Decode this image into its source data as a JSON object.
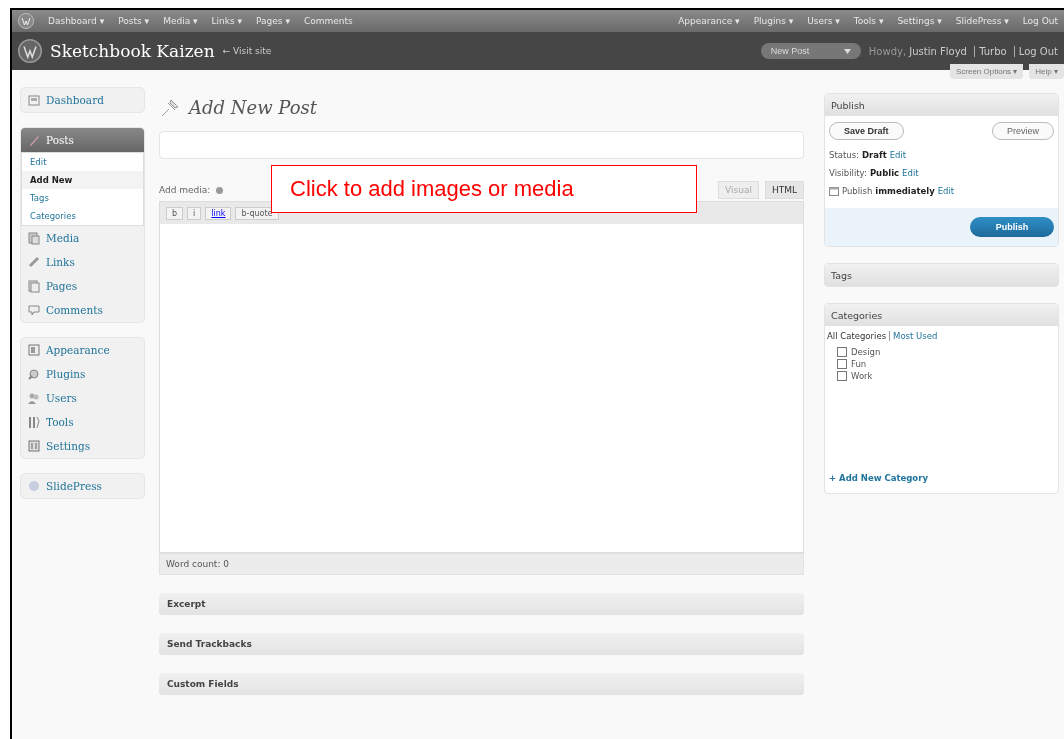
{
  "admin_bar": {
    "left": [
      "Dashboard ▾",
      "Posts ▾",
      "Media ▾",
      "Links ▾",
      "Pages ▾",
      "Comments"
    ],
    "right": [
      "Appearance ▾",
      "Plugins ▾",
      "Users ▾",
      "Tools ▾",
      "Settings ▾",
      "SlidePress ▾",
      "Log Out"
    ]
  },
  "header": {
    "site_title": "Sketchbook Kaizen",
    "visit_site": "← Visit site",
    "new_post": "New Post",
    "howdy": "Howdy,",
    "user": "Justin Floyd",
    "turbo": "Turbo",
    "log_out": "Log Out"
  },
  "screen_options": [
    "Screen Options ▾",
    "Help ▾"
  ],
  "sidebar": {
    "groups": [
      [
        {
          "label": "Dashboard",
          "selected": false
        }
      ],
      [
        {
          "label": "Posts",
          "selected": true,
          "children": [
            {
              "label": "Edit",
              "selected": false
            },
            {
              "label": "Add New",
              "selected": true
            },
            {
              "label": "Tags",
              "selected": false
            },
            {
              "label": "Categories",
              "selected": false
            }
          ]
        },
        {
          "label": "Media",
          "selected": false
        },
        {
          "label": "Links",
          "selected": false
        },
        {
          "label": "Pages",
          "selected": false
        },
        {
          "label": "Comments",
          "selected": false
        }
      ],
      [
        {
          "label": "Appearance",
          "selected": false
        },
        {
          "label": "Plugins",
          "selected": false
        },
        {
          "label": "Users",
          "selected": false
        },
        {
          "label": "Tools",
          "selected": false
        },
        {
          "label": "Settings",
          "selected": false
        }
      ],
      [
        {
          "label": "SlidePress",
          "selected": false
        }
      ]
    ]
  },
  "page_title": "Add New Post",
  "editor": {
    "add_media": "Add media:",
    "tabs": [
      {
        "label": "Visual",
        "selected": false
      },
      {
        "label": "HTML",
        "selected": true
      }
    ],
    "toolbar": [
      "b",
      "i",
      "link",
      "b-quote"
    ],
    "word_count": "Word count: 0"
  },
  "callout": "Click to add images or media",
  "boxes": [
    "Excerpt",
    "Send Trackbacks",
    "Custom Fields"
  ],
  "publish": {
    "title": "Publish",
    "save_draft": "Save Draft",
    "preview": "Preview",
    "rows": [
      {
        "label": "Status:",
        "value": "Draft",
        "link": "Edit"
      },
      {
        "label": "Visibility:",
        "value": "Public",
        "link": "Edit"
      },
      {
        "label": "Publish",
        "value": "immediately",
        "link": "Edit"
      }
    ],
    "button": "Publish"
  },
  "tags": {
    "title": "Tags"
  },
  "categories": {
    "title": "Categories",
    "tabs": [
      "All Categories",
      "Most Used"
    ],
    "items": [
      {
        "label": "Design",
        "checked": false
      },
      {
        "label": "Fun",
        "checked": false
      },
      {
        "label": "Work",
        "checked": false
      }
    ],
    "add_new": "+ Add New Category"
  }
}
